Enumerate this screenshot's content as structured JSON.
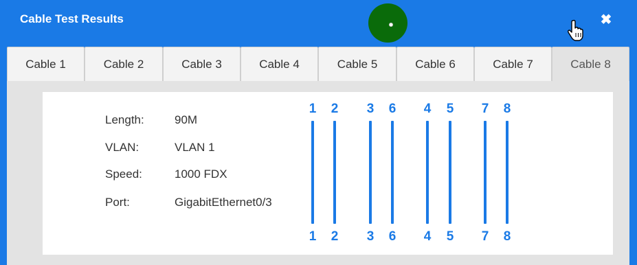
{
  "window": {
    "title": "Cable Test Results",
    "close_icon": "close-icon"
  },
  "tabs": [
    {
      "label": "Cable 1"
    },
    {
      "label": "Cable 2"
    },
    {
      "label": "Cable 3"
    },
    {
      "label": "Cable 4"
    },
    {
      "label": "Cable 5"
    },
    {
      "label": "Cable 6"
    },
    {
      "label": "Cable 7"
    },
    {
      "label": "Cable 8",
      "active": true
    }
  ],
  "info": [
    {
      "label": "Length:",
      "value": "90M"
    },
    {
      "label": "VLAN:",
      "value": "VLAN 1"
    },
    {
      "label": "Speed:",
      "value": "1000 FDX"
    },
    {
      "label": "Port:",
      "value": "GigabitEthernet0/3"
    }
  ],
  "pins": {
    "top": [
      "1",
      "2",
      "3",
      "6",
      "4",
      "5",
      "7",
      "8"
    ],
    "bottom": [
      "1",
      "2",
      "3",
      "6",
      "4",
      "5",
      "7",
      "8"
    ]
  },
  "colors": {
    "accent": "#1a7ae6",
    "record_dot": "#0a6b0a"
  }
}
